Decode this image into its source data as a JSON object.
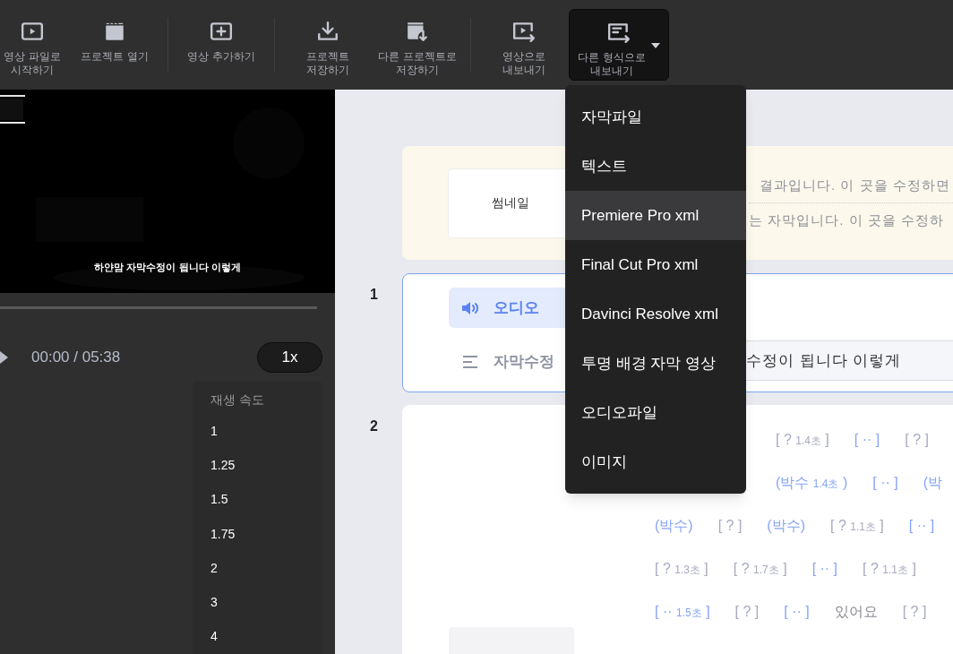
{
  "toolbar": {
    "items": [
      {
        "kind": "button",
        "label_lines": [
          "영상 파일로",
          "시작하기"
        ],
        "selected": false
      },
      {
        "kind": "button",
        "label_lines": [
          "프로젝트 열기"
        ],
        "selected": false
      },
      {
        "kind": "separator"
      },
      {
        "kind": "button",
        "label_lines": [
          "영상 추가하기"
        ],
        "selected": false
      },
      {
        "kind": "separator"
      },
      {
        "kind": "button",
        "label_lines": [
          "프로젝트",
          "저장하기"
        ],
        "selected": false
      },
      {
        "kind": "button",
        "label_lines": [
          "다른 프로젝트로",
          "저장하기"
        ],
        "selected": false
      },
      {
        "kind": "separator"
      },
      {
        "kind": "button",
        "label_lines": [
          "영상으로",
          "내보내기"
        ],
        "selected": false
      },
      {
        "kind": "button",
        "label_lines": [
          "다른 형식으로",
          "내보내기"
        ],
        "selected": true
      }
    ]
  },
  "export_menu": {
    "items": [
      {
        "label": "자막파일",
        "selected": false
      },
      {
        "label": "텍스트",
        "selected": false
      },
      {
        "label": "Premiere Pro xml",
        "selected": true
      },
      {
        "label": "Final Cut Pro xml",
        "selected": false
      },
      {
        "label": "Davinci Resolve xml",
        "selected": false
      },
      {
        "label": "투명 배경 자막 영상",
        "selected": false
      },
      {
        "label": "오디오파일",
        "selected": false
      },
      {
        "label": "이미지",
        "selected": false
      }
    ]
  },
  "player": {
    "subtitle": "하얀맘 자막수정이 됩니다 이렇게",
    "time": "00:00 / 05:38",
    "speed": "1x",
    "speed_menu": {
      "title": "재생 속도",
      "options": [
        {
          "label": "1"
        },
        {
          "label": "1.25"
        },
        {
          "label": "1.5"
        },
        {
          "label": "1.75"
        },
        {
          "label": "2"
        },
        {
          "label": "3"
        },
        {
          "label": "4"
        }
      ]
    }
  },
  "header": {
    "thumbnail_label": "썸네일",
    "lines": [
      "결과입니다. 이 곳을 수정하면",
      "는 자막입니다. 이 곳을 수정하"
    ]
  },
  "segments": [
    {
      "number": "1",
      "selected": true,
      "tabs": [
        {
          "kind": "audio",
          "label": "오디오",
          "selected": true
        },
        {
          "kind": "subtitle",
          "label": "자막수정",
          "selected": false
        }
      ],
      "subtitle_text": "수정이 됩니다 이렇게"
    },
    {
      "number": "2",
      "selected": false,
      "token_lines": [
        [
          {
            "kind": "unknown",
            "text": "[ ?",
            "duration": "1.4초",
            "close": "]"
          },
          {
            "kind": "pause",
            "text": "[ ·· ]"
          },
          {
            "kind": "unknown",
            "text": "[ ? ]"
          }
        ],
        [
          {
            "kind": "clap",
            "text": "(박수",
            "duration": "1.4초",
            "close": ")"
          },
          {
            "kind": "pause",
            "text": "[ ·· ]"
          },
          {
            "kind": "clap",
            "text": "(박"
          }
        ],
        [
          {
            "kind": "clap",
            "text": "(박수)"
          },
          {
            "kind": "unknown",
            "text": "[ ? ]"
          },
          {
            "kind": "clap",
            "text": "(박수)"
          },
          {
            "kind": "unknown",
            "text": "[ ?",
            "duration": "1.1초",
            "close": "]"
          },
          {
            "kind": "pause",
            "text": "[ ·· ]"
          }
        ],
        [
          {
            "kind": "unknown",
            "text": "[ ?",
            "duration": "1.3초",
            "close": "]"
          },
          {
            "kind": "unknown",
            "text": "[ ?",
            "duration": "1.7초",
            "close": "]"
          },
          {
            "kind": "pause",
            "text": "[ ·· ]"
          },
          {
            "kind": "unknown",
            "text": "[ ?",
            "duration": "1.1초",
            "close": "]"
          }
        ],
        [
          {
            "kind": "pause",
            "text": "[ ··",
            "duration": "1.5초",
            "close": "]"
          },
          {
            "kind": "unknown",
            "text": "[ ? ]"
          },
          {
            "kind": "pause",
            "text": "[ ·· ]"
          },
          {
            "kind": "word",
            "text": "있어요"
          },
          {
            "kind": "unknown",
            "text": "[ ? ]"
          }
        ]
      ]
    }
  ]
}
